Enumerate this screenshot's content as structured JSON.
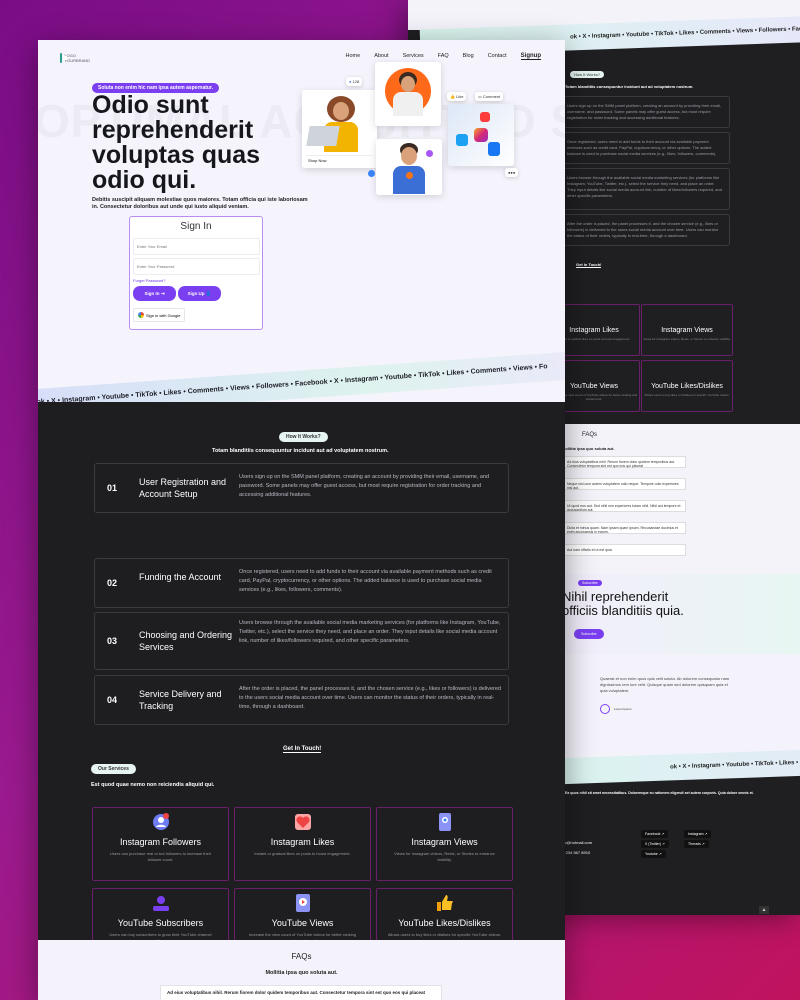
{
  "nav": {
    "logo_text": "LOGO\nYOURBRAND",
    "links": [
      "Home",
      "About",
      "Services",
      "FAQ",
      "Blog",
      "Contact"
    ],
    "signup": "Signup"
  },
  "hero": {
    "badge": "Soluta non enim hic nam ipsa autem aspernatur.",
    "title": "Odio sunt reprehenderit voluptas quas odio qui.",
    "description": "Debitis suscipit aliquam molestiae quos maiores. Totam officia qui iste laboriosam in. Consectetur doloribus aut unde qui iusto aliquid veniam.",
    "bg_text": "OPTIMAL ACQUITTED SHOCH GENEOU TRAJECTORY"
  },
  "signin": {
    "title": "Sign In",
    "email_placeholder": "Enter Your Email",
    "password_placeholder": "Enter Your Password",
    "forgot": "Forget Password?",
    "signin_btn": "Sign In",
    "signup_btn": "Sign Up",
    "google_btn": "Sign in with Google"
  },
  "collage": {
    "like": "Like",
    "comment": "Comment",
    "count": "128",
    "shop": "Shop Now"
  },
  "ticker": "ok • X • Instagram • Youtube • TikTok • Likes • Comments • Views • Followers • Facebook • X • Instagram • Youtube • TikTok • Likes • Comments • Views • Fo",
  "how": {
    "badge": "How It Works?",
    "subtitle": "Totam blanditiis consequuntur incidunt aut ad voluptatem nostrum.",
    "steps": [
      {
        "num": "01",
        "title": "User Registration and Account Setup",
        "desc": "Users sign up on the SMM panel platform, creating an account by providing their email, username, and password. Some panels may offer guest access, but most require registration for order tracking and accessing additional features."
      },
      {
        "num": "02",
        "title": "Funding the Account",
        "desc": "Once registered, users need to add funds to their account via available payment methods such as credit card, PayPal, cryptocurrency, or other options. The added balance is used to purchase social media services (e.g., likes, followers, comments)."
      },
      {
        "num": "03",
        "title": "Choosing and Ordering Services",
        "desc": "Users browse through the available social media marketing services (for platforms like Instagram, YouTube, Twitter, etc.), select the service they need, and place an order. They input details like social media account link, number of likes/followers required, and other specific parameters."
      },
      {
        "num": "04",
        "title": "Service Delivery and Tracking",
        "desc": "After the order is placed, the panel processes it, and the chosen service (e.g., likes or followers) is delivered to the users social media account over time. Users can monitor the status of their orders, typically in real-time, through a dashboard."
      }
    ],
    "cta": "Get In Touch!"
  },
  "services": {
    "badge": "Our Services",
    "subtitle": "Est quod quae nemo non reiciendis aliquid qui.",
    "items": [
      {
        "title": "Instagram Followers",
        "desc": "Users can purchase real or bot followers to increase their follower count.",
        "icon": "followers-icon"
      },
      {
        "title": "Instagram Likes",
        "desc": "Instant or gradual likes on posts to boost engagement.",
        "icon": "heart-icon"
      },
      {
        "title": "Instagram Views",
        "desc": "Views for Instagram videos, Reels, or Stories to enhance visibility.",
        "icon": "views-icon"
      },
      {
        "title": "YouTube Subscribers",
        "desc": "Users can buy subscribers to grow their YouTube channel audience.",
        "icon": "subscribe-icon"
      },
      {
        "title": "YouTube Views",
        "desc": "Increase the view count of YouTube videos for better ranking and social proof.",
        "icon": "play-icon"
      },
      {
        "title": "YouTube Likes/Dislikes",
        "desc": "Allows users to buy likes or dislikes for specific YouTube videos.",
        "icon": "thumbs-up-icon"
      }
    ]
  },
  "faq": {
    "title": "FAQs",
    "subtitle": "Mollitia ipsa quo soluta aut.",
    "first_question": "Ad eius voluptatibus nihil. Rerum fiorem dolor quidem temporibus aut. Consectetur tempora sint est quo eos qui placeat"
  },
  "back": {
    "how_badge": "How It Works?",
    "how_sub": "Totam blanditiis consequuntur incidunt aut ad voluptatem nostrum.",
    "step_snippets": [
      "Users sign up on the SMM panel platform, creating an account by providing their email, username, and password. Some panels may offer guest access, but most require registration for order tracking and accessing additional features.",
      "Once registered, users need to add funds to their account via available payment methods such as credit card, PayPal, cryptocurrency, or other options. The added balance is used to purchase social media services (e.g., likes, followers, comments).",
      "Users browse through the available social media marketing services (for platforms like Instagram, YouTube, Twitter, etc.), select the service they need, and place an order. They input details like social media account link, number of likes/followers required, and other specific parameters.",
      "After the order is placed, the panel processes it, and the chosen service (e.g., likes or followers) is delivered to the users social media account over time. Users can monitor the status of their orders, typically in real-time, through a dashboard."
    ],
    "touch": "Get In Touch!",
    "services": [
      {
        "title": "Instagram Likes",
        "desc": "Instant or gradual likes on posts to boost engagement."
      },
      {
        "title": "Instagram Views",
        "desc": "Views for Instagram videos, Reels, or Stories to enhance visibility."
      },
      {
        "title": "YouTube Views",
        "desc": "Increase the view count of YouTube videos for better ranking and social proof."
      },
      {
        "title": "YouTube Likes/Dislikes",
        "desc": "Allows users to buy likes or dislikes for specific YouTube videos."
      }
    ],
    "faq_title": "FAQs",
    "faq_sub": "Mollitia ipsa quo soluta aut.",
    "faq_items": [
      "Ad eius voluptatibus nihil. Rerum fiorem dolor quidem temporibus aut. Consectetur tempora sint est quo eos qui placeat",
      "Neque nisi cum autem voluptatem odio neque. Tempore odio experiores nisi aut.",
      "Ut quod eos aut. Sed nihil non experiores totam nihil. Nihil aut tempore et accusantium aut.",
      "Dicta et minus quam. Nam ipsam quam ipsum. Recusandae ducimus et enim accusamus in earum.",
      "Aut nam officiis et ut est quia."
    ],
    "subscribe_badge": "Subscribe",
    "subscribe_title": "Nihil reprehenderit officiis blanditiis quia.",
    "subscribe_btn": "Subscribe",
    "testimonial": "Quaerat et non enim quos quis velit soluta. Ab dolorem consequatur nam dignissimos rem iure velit. Quisque quam sed dolorem quisquam quia et quia voluptatem.",
    "testimonial_name": "Lorem Ipsum",
    "footer_text": "Ea quos nihil sit amet necessitatibus. Doloremque eu rationem eligendi set autem corporis. Quia dolore omnis et.",
    "email": "info@hotmail.com",
    "phone": "+1 234 567 8910",
    "social": [
      "Facebook ↗",
      "Instagram ↗",
      "X (Twitter) ↗",
      "Threads ↗",
      "Youtube ↗"
    ]
  }
}
